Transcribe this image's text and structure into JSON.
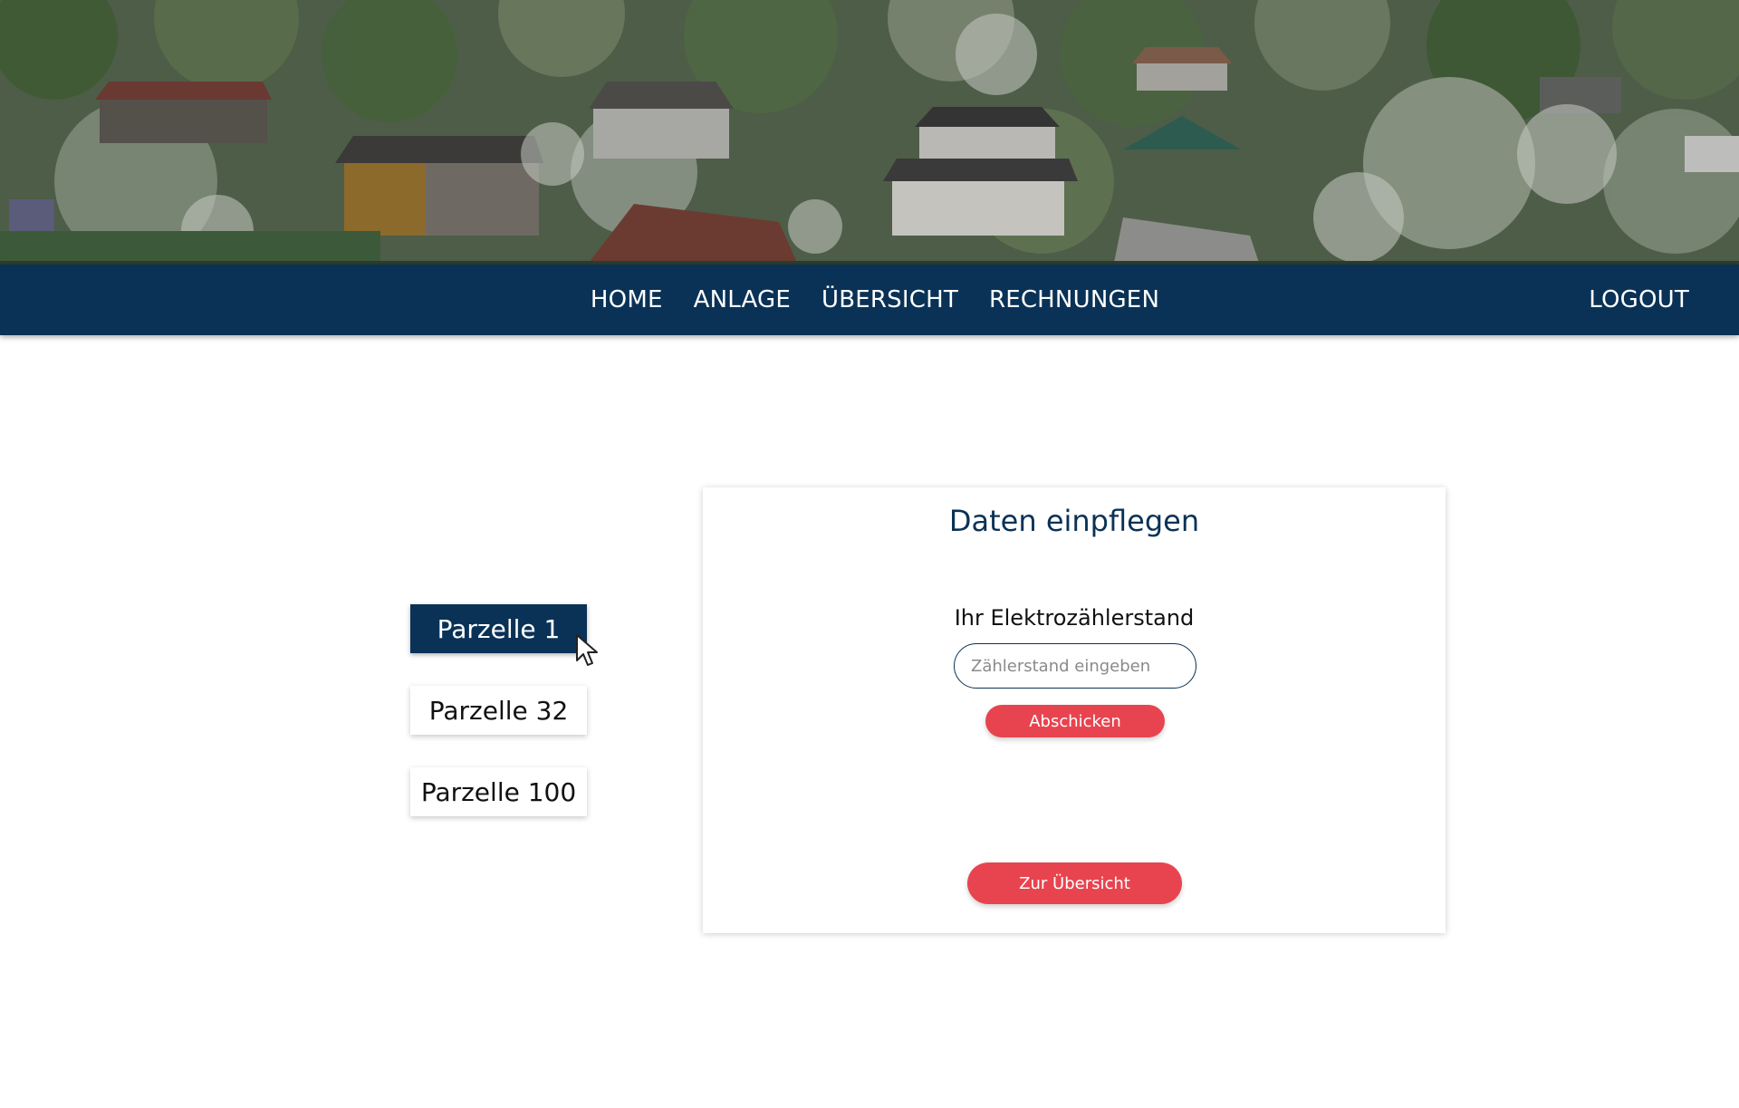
{
  "nav": {
    "items": [
      {
        "label": "HOME"
      },
      {
        "label": "ANLAGE"
      },
      {
        "label": "ÜBERSICHT"
      },
      {
        "label": "RECHNUNGEN"
      }
    ],
    "logout_label": "LOGOUT"
  },
  "parcels": {
    "items": [
      {
        "label": "Parzelle 1",
        "active": true
      },
      {
        "label": "Parzelle 32",
        "active": false
      },
      {
        "label": "Parzelle 100",
        "active": false
      }
    ]
  },
  "card": {
    "title": "Daten einpflegen",
    "field_label": "Ihr Elektrozählerstand",
    "input_placeholder": "Zählerstand eingeben",
    "input_value": "",
    "submit_label": "Abschicken",
    "overview_label": "Zur Übersicht"
  },
  "colors": {
    "primary": "#0a3256",
    "accent": "#e8444f",
    "background": "#ffffff"
  },
  "icons": {
    "cursor": "arrow-pointer-icon"
  }
}
